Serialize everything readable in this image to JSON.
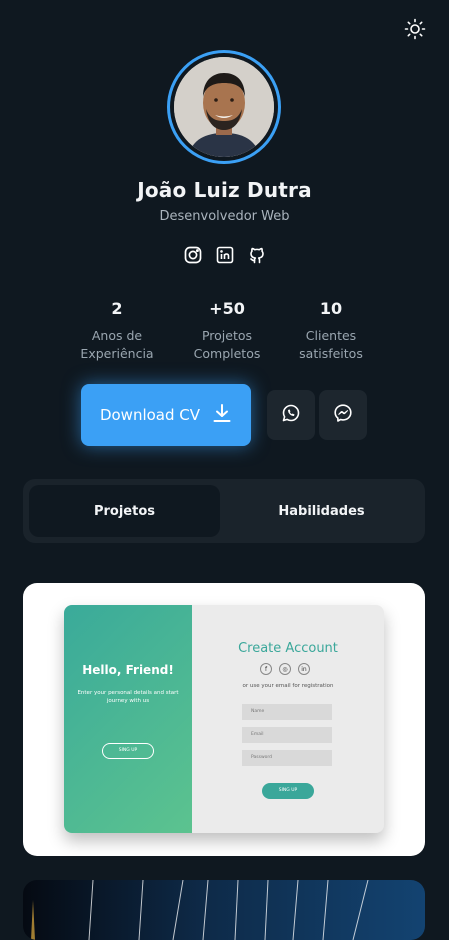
{
  "profile": {
    "name": "João Luiz Dutra",
    "role": "Desenvolvedor Web"
  },
  "socials": [
    "instagram-icon",
    "linkedin-icon",
    "github-icon"
  ],
  "stats": [
    {
      "value": "2",
      "label_line1": "Anos de",
      "label_line2": "Experiência"
    },
    {
      "value": "+50",
      "label_line1": "Projetos",
      "label_line2": "Completos"
    },
    {
      "value": "10",
      "label_line1": "Clientes",
      "label_line2": "satisfeitos"
    }
  ],
  "actions": {
    "download_label": "Download CV",
    "whatsapp": "whatsapp-icon",
    "messenger": "messenger-icon"
  },
  "tabs": [
    {
      "label": "Projetos",
      "active": true
    },
    {
      "label": "Habilidades",
      "active": false
    }
  ],
  "project_preview": {
    "hello": "Hello, Friend!",
    "subtitle": "Enter your personal details and start journey with us",
    "sign_in": "SING UP",
    "create_account": "Create Account",
    "social_letters": [
      "f",
      "◎",
      "in"
    ],
    "or_text": "or use your email for registration",
    "field_name": "Name",
    "field_email": "Email",
    "field_password": "Password",
    "sign_up": "SING UP"
  },
  "colors": {
    "background": "#0f1820",
    "accent": "#3ba0f5",
    "card": "#1a232b",
    "preview_green": "#3aa79a"
  }
}
